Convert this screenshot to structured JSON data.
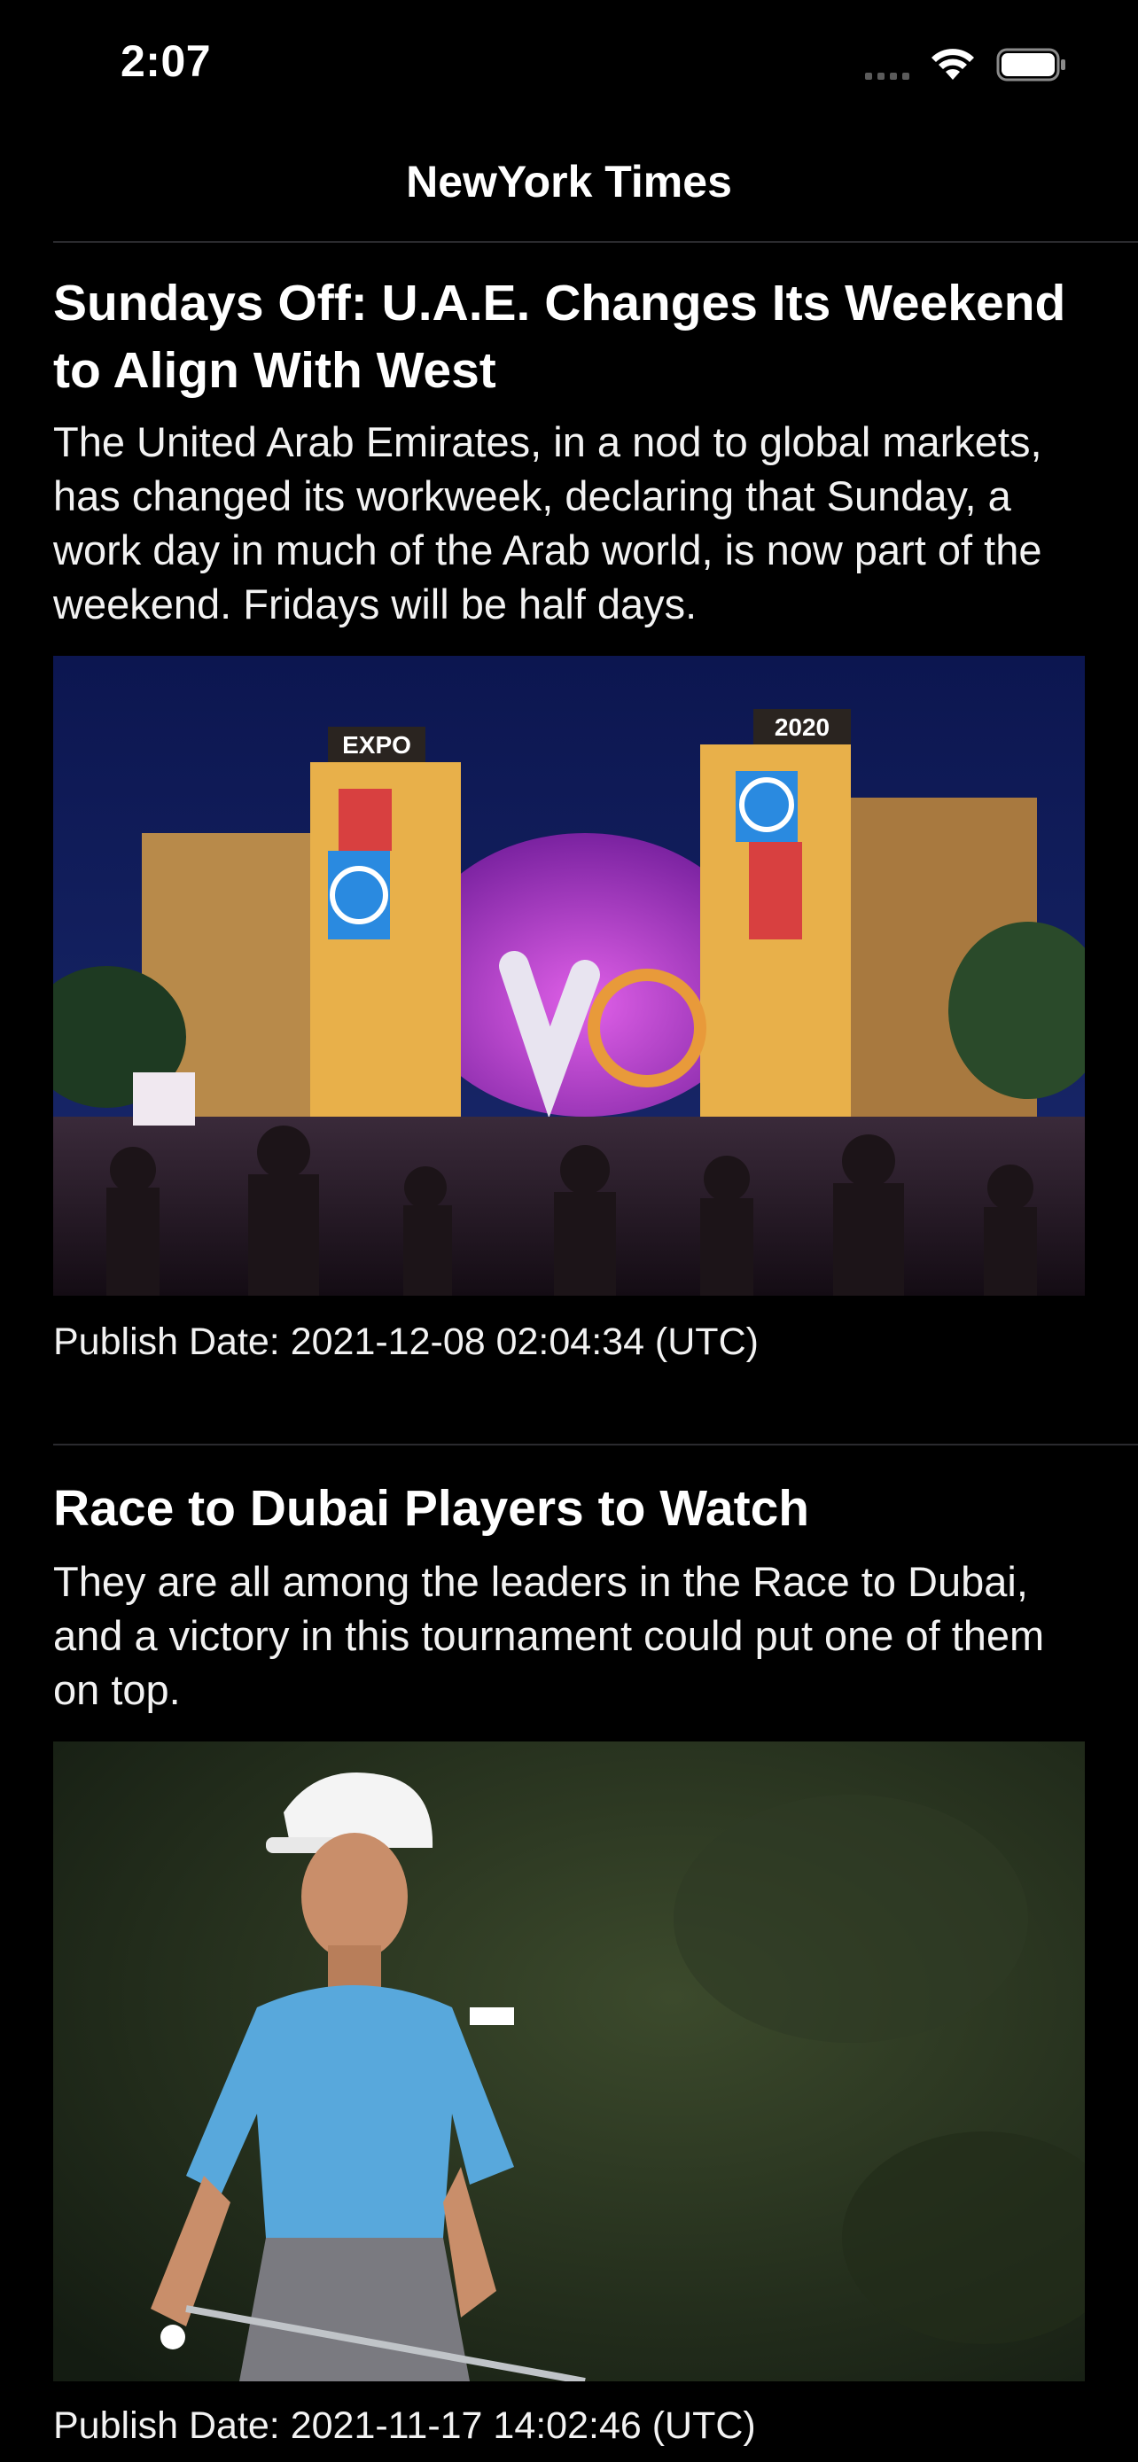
{
  "status_bar": {
    "time": "2:07",
    "icons": [
      "cellular-signal-icon",
      "wifi-icon",
      "battery-icon"
    ]
  },
  "nav": {
    "title": "NewYork Times"
  },
  "articles": [
    {
      "headline": "Sundays Off: U.A.E. Changes Its Weekend to Align With West",
      "abstract": "The United Arab Emirates, in a nod to global markets, has changed its workweek, declaring that Sunday, a work day in much of the Arab world, is now part of the weekend. Fridays will be half days.",
      "image_text": {
        "expo": "EXPO",
        "year": "2020"
      },
      "publish": "Publish Date: 2021-12-08 02:04:34 (UTC)"
    },
    {
      "headline": "Race to Dubai Players to Watch",
      "abstract": "They are all among the leaders in the Race to Dubai, and a victory in this tournament could put one of them on top.",
      "publish": "Publish Date: 2021-11-17 14:02:46 (UTC)"
    }
  ],
  "colors": {
    "background": "#000000",
    "text": "#ffffff",
    "divider": "#2a2a2e",
    "night_sky": "#0f1a4a",
    "dome": "#b43fc8",
    "shirt": "#58a8dc"
  }
}
